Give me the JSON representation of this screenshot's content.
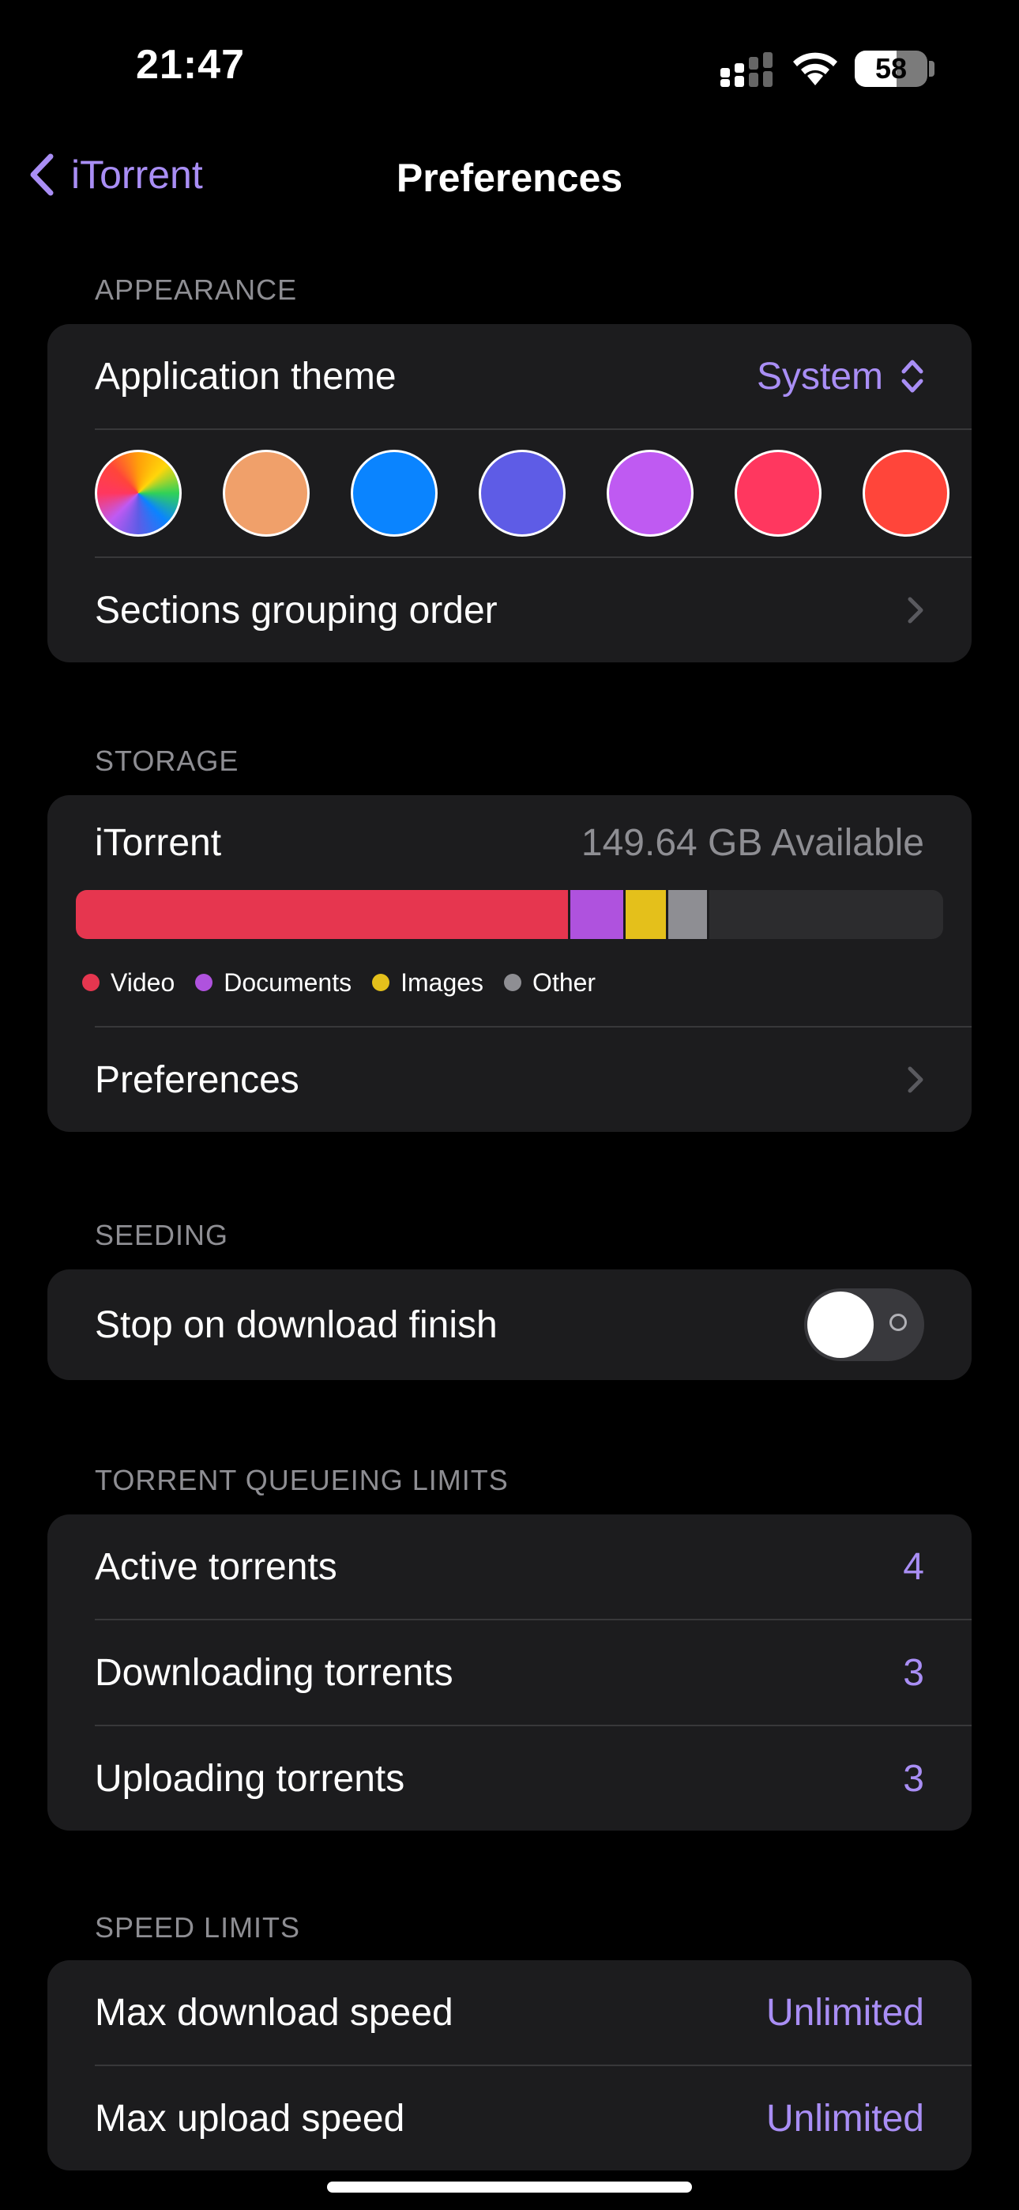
{
  "status": {
    "time": "21:47",
    "battery": "58",
    "battery_level": 0.58
  },
  "nav": {
    "back_label": "iTorrent",
    "title": "Preferences"
  },
  "appearance": {
    "header": "APPEARANCE",
    "theme_label": "Application theme",
    "theme_value": "System",
    "swatches": [
      "multicolor",
      "#f0a06a",
      "#0a84ff",
      "#5e5ce6",
      "#bf5af2",
      "#ff375f",
      "#ff453a"
    ],
    "grouping_label": "Sections grouping order"
  },
  "storage": {
    "header": "STORAGE",
    "app_label": "iTorrent",
    "available": "149.64 GB Available",
    "usage": [
      {
        "name": "Video",
        "color": "#e6364f",
        "fraction": 0.57
      },
      {
        "name": "Documents",
        "color": "#af52de",
        "fraction": 0.064
      },
      {
        "name": "Images",
        "color": "#e4c01b",
        "fraction": 0.049
      },
      {
        "name": "Other",
        "color": "#8e8e93",
        "fraction": 0.047
      }
    ],
    "preferences_label": "Preferences"
  },
  "seeding": {
    "header": "SEEDING",
    "stop_label": "Stop on download finish",
    "stop_enabled": false
  },
  "queue": {
    "header": "TORRENT QUEUEING LIMITS",
    "rows": [
      {
        "label": "Active torrents",
        "value": "4"
      },
      {
        "label": "Downloading torrents",
        "value": "3"
      },
      {
        "label": "Uploading torrents",
        "value": "3"
      }
    ]
  },
  "speed": {
    "header": "SPEED LIMITS",
    "rows": [
      {
        "label": "Max download speed",
        "value": "Unlimited"
      },
      {
        "label": "Max upload speed",
        "value": "Unlimited"
      }
    ]
  },
  "colors": {
    "accent": "#a98ef5",
    "background": "#000000",
    "card": "#1c1c1e"
  }
}
